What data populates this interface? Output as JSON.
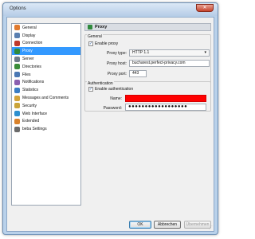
{
  "window": {
    "title": "Options",
    "close_glyph": "✕"
  },
  "sidebar": {
    "items": [
      {
        "label": "General",
        "icon": "general-icon",
        "color": "#e07a2e"
      },
      {
        "label": "Display",
        "icon": "display-icon",
        "color": "#5a7fb0"
      },
      {
        "label": "Connection",
        "icon": "connection-icon",
        "color": "#c0392b"
      },
      {
        "label": "Proxy",
        "icon": "proxy-icon",
        "color": "#2f8a3c",
        "selected": true
      },
      {
        "label": "Server",
        "icon": "server-icon",
        "color": "#6c7a89"
      },
      {
        "label": "Directories",
        "icon": "directories-icon",
        "color": "#3a8d3a"
      },
      {
        "label": "Files",
        "icon": "files-icon",
        "color": "#4a78b5"
      },
      {
        "label": "Notifications",
        "icon": "notifications-icon",
        "color": "#8a5fb0"
      },
      {
        "label": "Statistics",
        "icon": "statistics-icon",
        "color": "#3b7dc4"
      },
      {
        "label": "Messages and Comments",
        "icon": "messages-icon",
        "color": "#d4a33a"
      },
      {
        "label": "Security",
        "icon": "security-icon",
        "color": "#caa43a"
      },
      {
        "label": "Web Interface",
        "icon": "web-interface-icon",
        "color": "#2d8fcf"
      },
      {
        "label": "Extended",
        "icon": "extended-icon",
        "color": "#d9822b"
      },
      {
        "label": "beba Settings",
        "icon": "beba-settings-icon",
        "color": "#6b6b6b"
      }
    ]
  },
  "panel": {
    "title": "Proxy",
    "general": {
      "title": "General",
      "enable_proxy_label": "Enable proxy",
      "enable_proxy_checked": true,
      "type_label": "Proxy type:",
      "type_value": "HTTP 1.1",
      "host_label": "Proxy host:",
      "host_value": "bucharest.perfect-privacy.com",
      "port_label": "Proxy port:",
      "port_value": "443"
    },
    "auth": {
      "title": "Authentication",
      "enable_auth_label": "Enable authentication",
      "enable_auth_checked": true,
      "name_label": "Name:",
      "password_label": "Password:",
      "password_value": "●●●●●●●●●●●●●●●●●●",
      "redaction_color": "#ff0000"
    }
  },
  "buttons": {
    "ok": "OK",
    "cancel": "Abbrechen",
    "apply": "Übernehmen"
  },
  "check_glyph": "✓",
  "dropdown_glyph": "▾"
}
